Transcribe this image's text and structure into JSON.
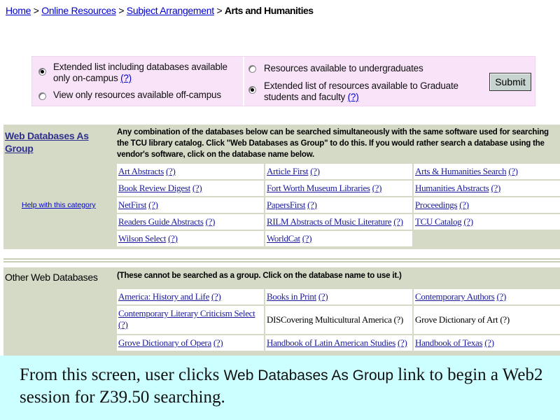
{
  "breadcrumb": {
    "items": [
      "Home",
      "Online Resources",
      "Subject Arrangement"
    ],
    "separator": ">",
    "current": "Arts and Humanities"
  },
  "filters": {
    "options": [
      {
        "text": "Extended list including databases available only on-campus",
        "help": "(?)",
        "selected": true
      },
      {
        "text": "View only resources available off-campus",
        "help": "",
        "selected": false
      },
      {
        "text": "Resources available to undergraduates",
        "help": "",
        "selected": false
      },
      {
        "text": "Extended list of resources available to Graduate students and faculty",
        "help": "(?)",
        "selected": true
      }
    ],
    "submit_label": "Submit"
  },
  "group_section": {
    "title": "Web Databases As Group",
    "help_link": "Help with this category",
    "description": "Any combination of the databases below can be searched simultaneously with the same software used for searching the TCU library catalog.   Click \"Web Databases as Group\" to do this.  If you would rather search a database using the vendor's software, click on the database name below.",
    "help_glyph": "(?)",
    "databases": [
      "Art Abstracts",
      "Article First",
      "Arts & Humanities Search",
      "Book Review Digest",
      "Fort Worth Museum Libraries",
      "Humanities Abstracts",
      "NetFirst",
      "PapersFirst",
      "Proceedings",
      "Readers Guide Abstracts",
      "RILM Abstracts of Music Literature",
      "TCU Catalog",
      "Wilson Select",
      "WorldCat"
    ]
  },
  "other_section": {
    "title": "Other Web Databases",
    "description": "(These cannot be searched as a group.  Click on the database name to use it.)",
    "databases": [
      "America: History and Life",
      "Books in Print",
      "Contemporary Authors",
      "Contemporary Literary Criticism Select",
      "DISCovering Multicultural America",
      "Grove Dictionary of Art",
      "Grove Dictionary of Opera",
      "Handbook of Latin American Studies",
      "Handbook of Texas"
    ]
  },
  "caption": {
    "before": "From this screen, user clicks ",
    "highlight": "Web Databases As Group",
    "after": " link to begin a Web2 session for Z39.50 searching."
  },
  "colors": {
    "link": "#0000cc",
    "filter_background": "#f9e3f9",
    "section_background": "#d4dac6",
    "caption_background": "#ccffff",
    "button_background": "#c6d3cf"
  }
}
